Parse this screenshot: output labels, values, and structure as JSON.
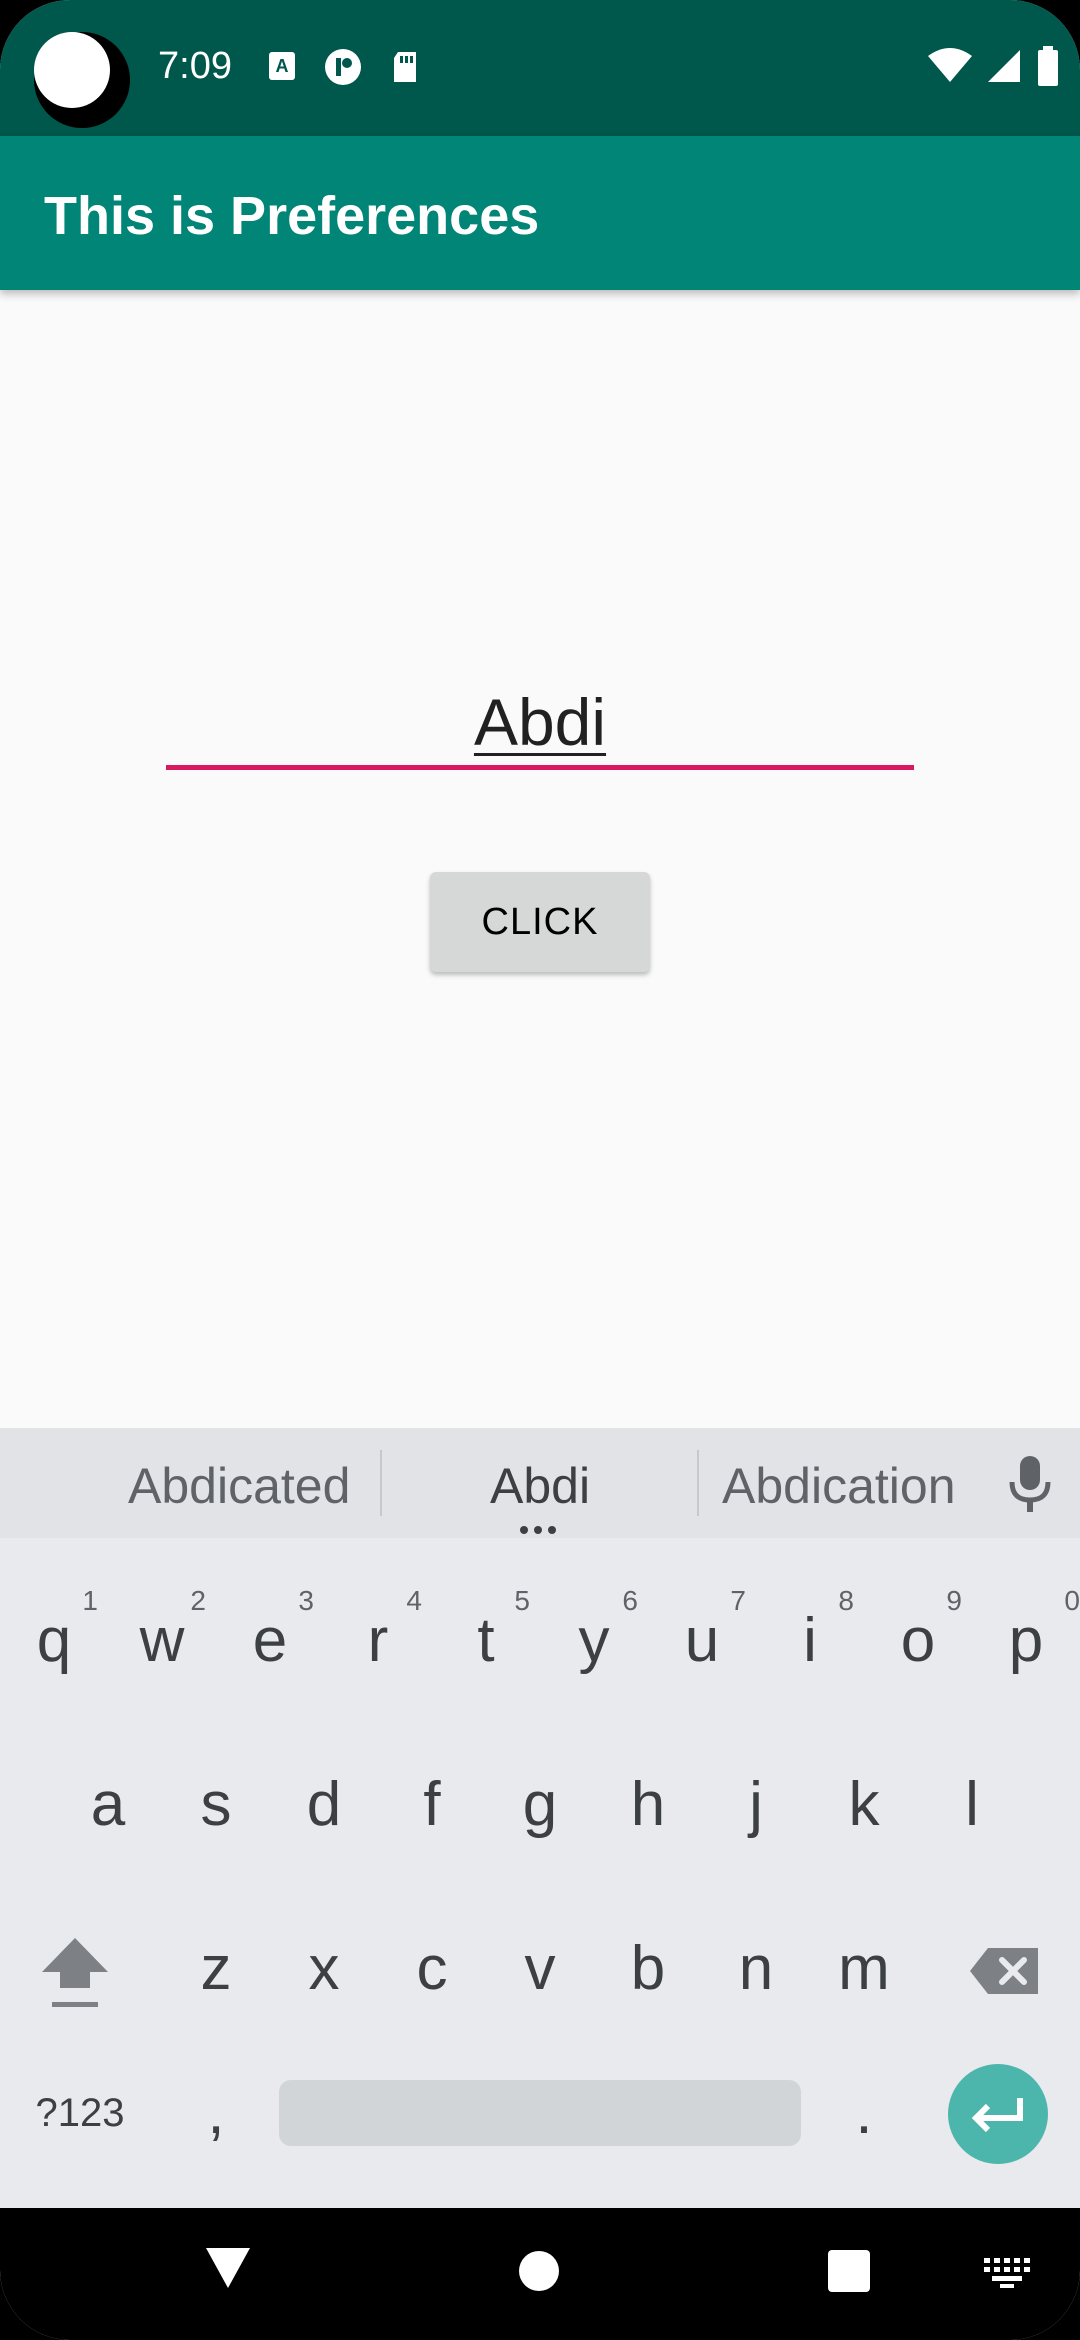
{
  "status_bar": {
    "time": "7:09",
    "icons": [
      "camera-cutout",
      "keyboard-a-icon",
      "notification-icon",
      "sd-card-icon",
      "wifi-icon",
      "signal-icon",
      "battery-icon"
    ]
  },
  "app_bar": {
    "title": "This is Preferences"
  },
  "form": {
    "input_value": "Abdi",
    "button_label": "CLICK"
  },
  "keyboard": {
    "suggestions": [
      "Abdicated",
      "Abdi",
      "Abdication"
    ],
    "row1": [
      {
        "label": "q",
        "hint": "1"
      },
      {
        "label": "w",
        "hint": "2"
      },
      {
        "label": "e",
        "hint": "3"
      },
      {
        "label": "r",
        "hint": "4"
      },
      {
        "label": "t",
        "hint": "5"
      },
      {
        "label": "y",
        "hint": "6"
      },
      {
        "label": "u",
        "hint": "7"
      },
      {
        "label": "i",
        "hint": "8"
      },
      {
        "label": "o",
        "hint": "9"
      },
      {
        "label": "p",
        "hint": "0"
      }
    ],
    "row2": [
      "a",
      "s",
      "d",
      "f",
      "g",
      "h",
      "j",
      "k",
      "l"
    ],
    "row3": [
      "z",
      "x",
      "c",
      "v",
      "b",
      "n",
      "m"
    ],
    "symbols_label": "?123",
    "comma_label": ",",
    "period_label": "."
  },
  "colors": {
    "status_bar": "#00574b",
    "app_bar": "#008577",
    "accent": "#d81b60",
    "enter_key": "#4db6ac"
  }
}
